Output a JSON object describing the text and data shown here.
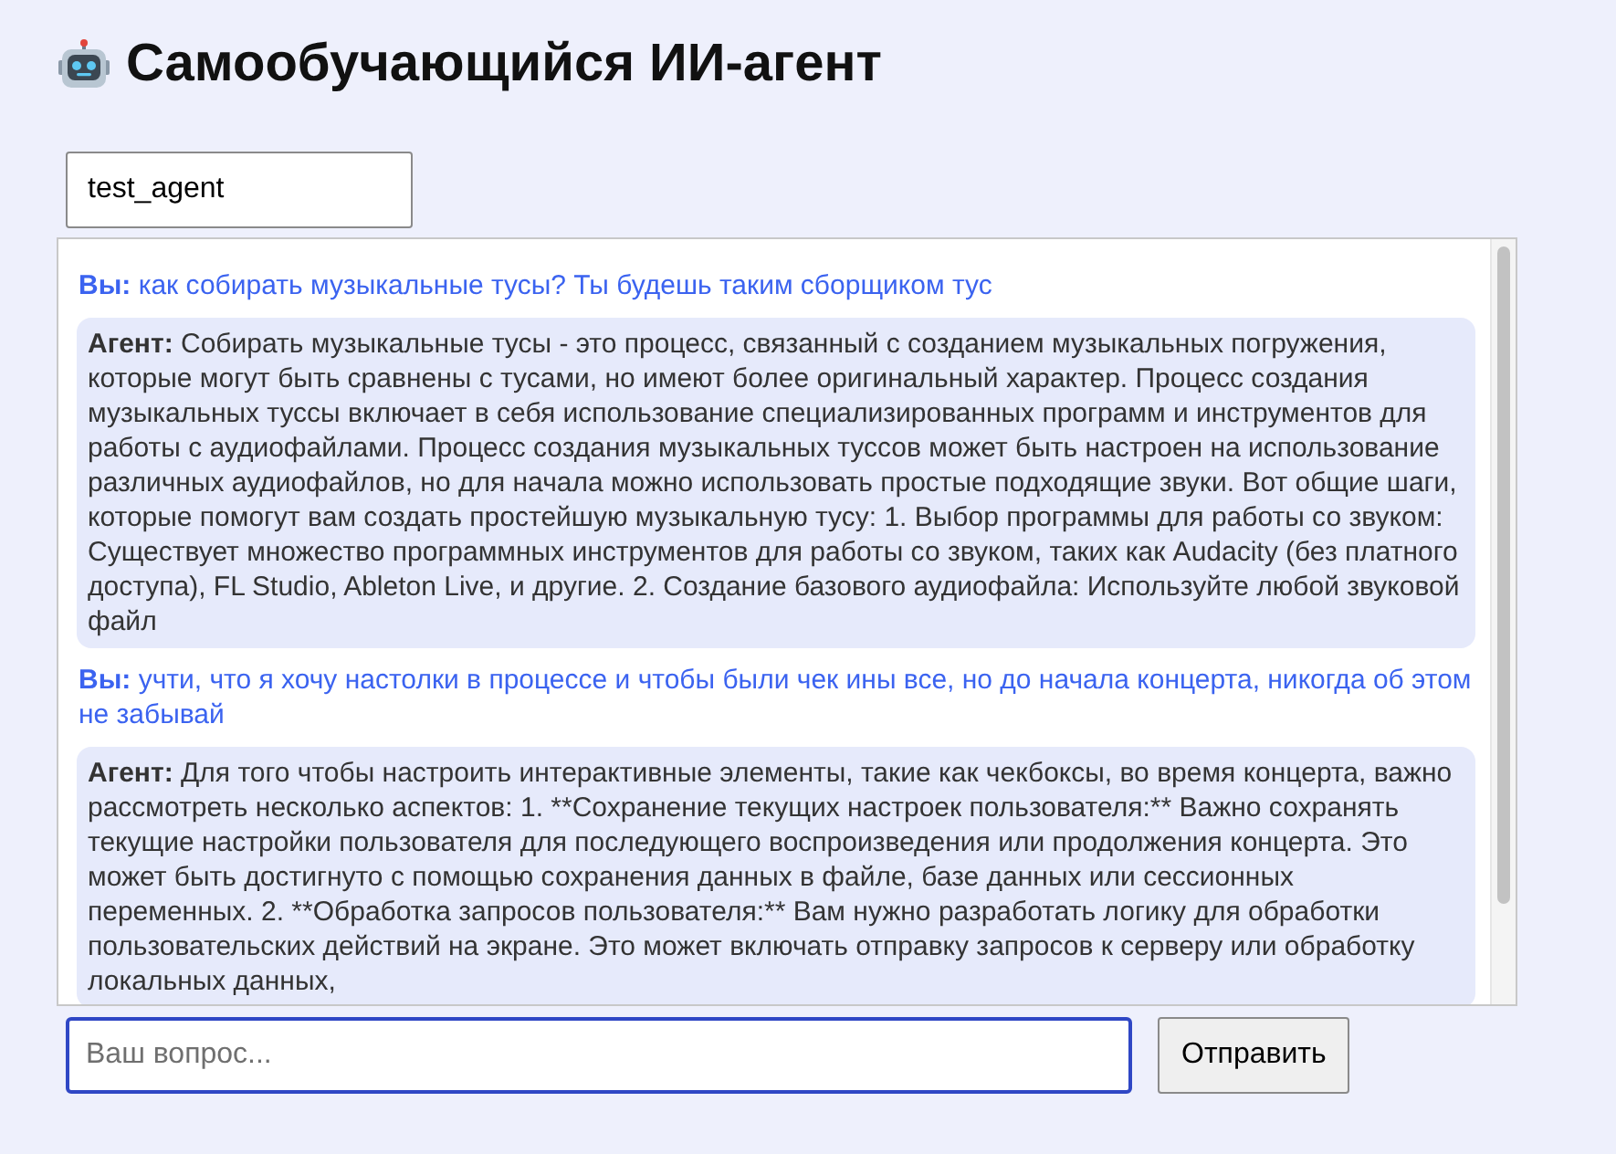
{
  "title": "Самообучающийся ИИ-агент",
  "agent_field": {
    "value": "test_agent"
  },
  "messages": [
    {
      "kind": "user",
      "speaker": "Вы:",
      "text": "как собирать музыкальные тусы? Ты будешь таким сборщиком тус"
    },
    {
      "kind": "agent",
      "speaker": "Агент:",
      "text": "Собирать музыкальные тусы - это процесс, связанный с созданием музыкальных погружения, которые могут быть сравнены с тусами, но имеют более оригинальный характер. Процесс создания музыкальных туссы включает в себя использование специализированных программ и инструментов для работы с аудиофайлами. Процесс создания музыкальных туссов может быть настроен на использование различных аудиофайлов, но для начала можно использовать простые подходящие звуки. Вот общие шаги, которые помогут вам создать простейшую музыкальную тусу: 1. Выбор программы для работы со звуком: Существует множество программных инструментов для работы со звуком, таких как Audacity (без платного доступа), FL Studio, Ableton Live, и другие. 2. Создание базового аудиофайла: Используйте любой звуковой файл"
    },
    {
      "kind": "user",
      "speaker": "Вы:",
      "text": "учти, что я хочу настолки в процессе и чтобы были чек ины все, но до начала концерта, никогда об этом не забывай"
    },
    {
      "kind": "agent",
      "speaker": "Агент:",
      "text": "Для того чтобы настроить интерактивные элементы, такие как чекбоксы, во время концерта, важно рассмотреть несколько аспектов: 1. **Сохранение текущих настроек пользователя:** Важно сохранять текущие настройки пользователя для последующего воспроизведения или продолжения концерта. Это может быть достигнуто с помощью сохранения данных в файле, базе данных или сессионных переменных. 2. **Обработка запросов пользователя:** Вам нужно разработать логику для обработки пользовательских действий на экране. Это может включать отправку запросов к серверу или обработку локальных данных,"
    }
  ],
  "question_field": {
    "placeholder": "Ваш вопрос..."
  },
  "send_button": {
    "label": "Отправить"
  }
}
